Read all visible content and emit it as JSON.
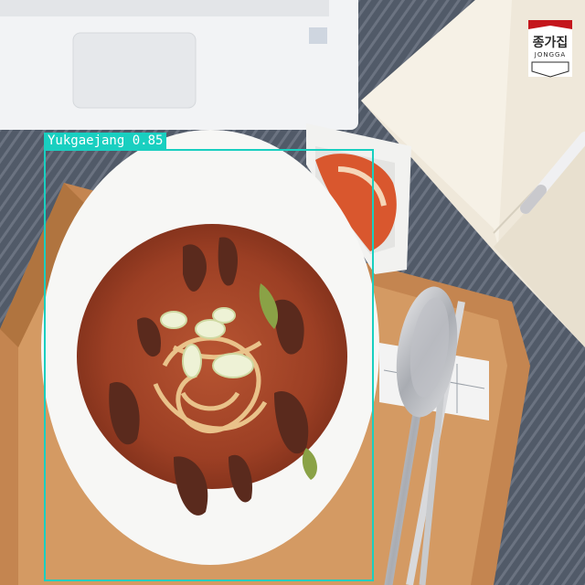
{
  "detection": {
    "label": "Yukgaejang 0.85",
    "box_color": "#19cfc0"
  },
  "logo": {
    "korean": "종가집",
    "english": "JONGGA",
    "accent_color": "#c4161c"
  },
  "colors": {
    "tablecloth": "#4f5663",
    "tray": "#c98a55",
    "bowl": "#f7f7f5",
    "soup": "#a8442a",
    "laptop": "#f2f3f5"
  }
}
